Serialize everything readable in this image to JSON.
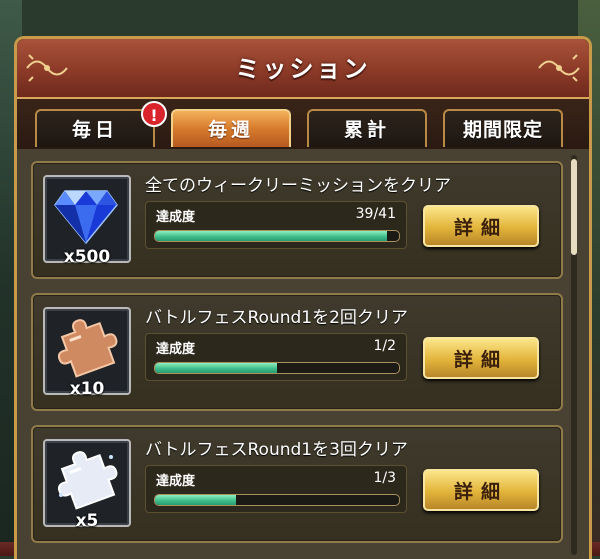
{
  "header": {
    "title": "ミッション"
  },
  "tabs": [
    {
      "label": "毎日",
      "active": false,
      "has_alert": true
    },
    {
      "label": "毎週",
      "active": true
    },
    {
      "label": "累計",
      "active": false
    },
    {
      "label": "期間限定",
      "active": false
    }
  ],
  "alert_badge": "!",
  "missions": [
    {
      "title": "全てのウィークリーミッションをクリア",
      "progress_label": "達成度",
      "progress_text": "39/41",
      "progress": 0.951,
      "reward_icon": "diamond-gem-icon",
      "reward_qty": "x500",
      "button_label": "詳細"
    },
    {
      "title": "バトルフェスRound1を2回クリア",
      "progress_label": "達成度",
      "progress_text": "1/2",
      "progress": 0.5,
      "reward_icon": "bronze-puzzle-piece-icon",
      "reward_qty": "x10",
      "button_label": "詳細"
    },
    {
      "title": "バトルフェスRound1を3回クリア",
      "progress_label": "達成度",
      "progress_text": "1/3",
      "progress": 0.333,
      "reward_icon": "silver-puzzle-piece-icon",
      "reward_qty": "x5",
      "button_label": "詳細"
    }
  ],
  "colors": {
    "accent_gold": "#d9a65a",
    "progress_green": "#3cb98a",
    "tab_active": "#d57a2c",
    "alert_red": "#d8242a"
  }
}
